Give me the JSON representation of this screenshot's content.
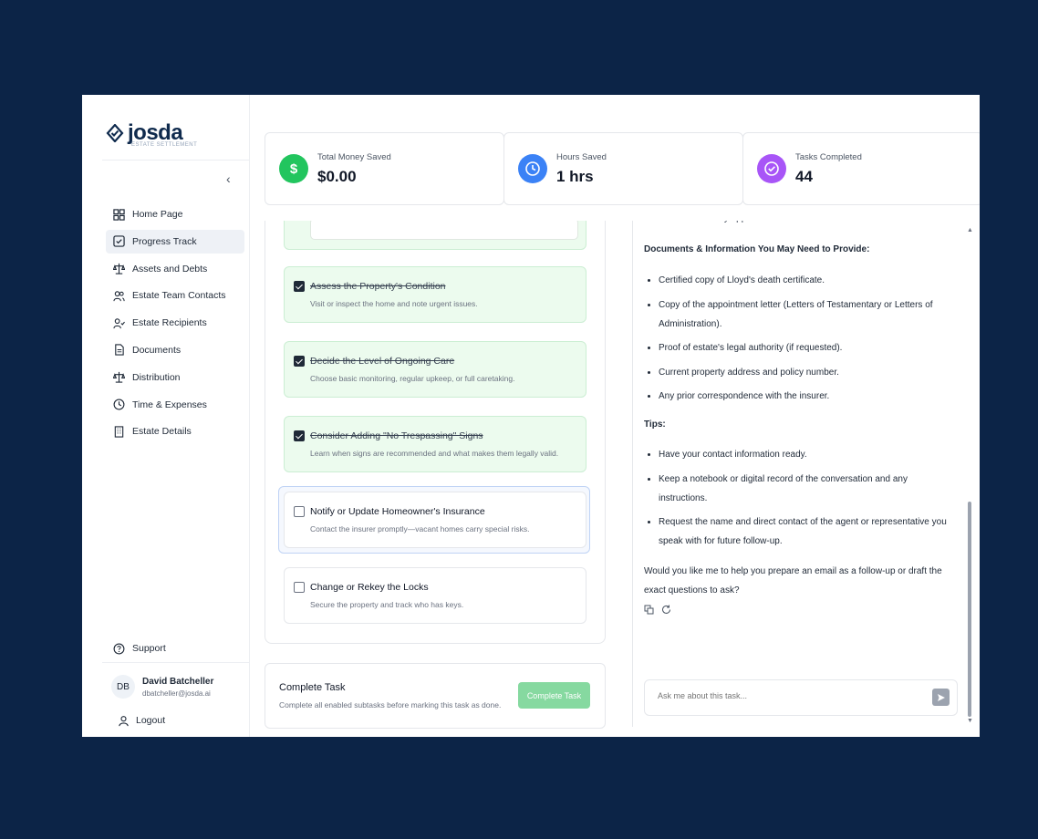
{
  "brand": {
    "name": "josda",
    "tagline": "ESTATE SETTLEMENT"
  },
  "sidebar": {
    "items": [
      {
        "label": "Home Page",
        "icon": "grid-icon"
      },
      {
        "label": "Progress Track",
        "icon": "checkbox-icon"
      },
      {
        "label": "Assets and Debts",
        "icon": "scale-icon"
      },
      {
        "label": "Estate Team Contacts",
        "icon": "users-icon"
      },
      {
        "label": "Estate Recipients",
        "icon": "user-check-icon"
      },
      {
        "label": "Documents",
        "icon": "file-icon"
      },
      {
        "label": "Distribution",
        "icon": "scale-icon"
      },
      {
        "label": "Time & Expenses",
        "icon": "clock-icon"
      },
      {
        "label": "Estate Details",
        "icon": "building-icon"
      }
    ],
    "support": "Support",
    "user": {
      "initials": "DB",
      "name": "David Batcheller",
      "email": "dbatcheller@josda.ai"
    },
    "logout": "Logout"
  },
  "stats": [
    {
      "label": "Total Money Saved",
      "value": "$0.00",
      "color": "#22c55e"
    },
    {
      "label": "Hours Saved",
      "value": "1 hrs",
      "color": "#3b82f6"
    },
    {
      "label": "Tasks Completed",
      "value": "44",
      "color": "#a855f7"
    }
  ],
  "tasks": [
    {
      "title": "Assess the Property's Condition",
      "desc": "Visit or inspect the home and note urgent issues.",
      "done": true
    },
    {
      "title": "Decide the Level of Ongoing Care",
      "desc": "Choose basic monitoring, regular upkeep, or full caretaking.",
      "done": true
    },
    {
      "title": "Consider Adding \"No Trespassing\" Signs",
      "desc": "Learn when signs are recommended and what makes them legally valid.",
      "done": true
    },
    {
      "title": "Notify or Update Homeowner's Insurance",
      "desc": "Contact the insurer promptly—vacant homes carry special risks.",
      "done": false
    },
    {
      "title": "Change or Rekey the Locks",
      "desc": "Secure the property and track who has keys.",
      "done": false
    }
  ],
  "complete": {
    "title": "Complete Task",
    "desc": "Complete all enabled subtasks before marking this task as done.",
    "button": "Complete Task"
  },
  "chat": {
    "partial_top": "documentation of my appointment as executor if needed.",
    "docs_heading": "Documents & Information You May Need to Provide:",
    "docs": [
      "Certified copy of Lloyd's death certificate.",
      "Copy of the appointment letter (Letters of Testamentary or Letters of Administration).",
      "Proof of estate's legal authority (if requested).",
      "Current property address and policy number.",
      "Any prior correspondence with the insurer."
    ],
    "tips_heading": "Tips:",
    "tips": [
      "Have your contact information ready.",
      "Keep a notebook or digital record of the conversation and any instructions.",
      "Request the name and direct contact of the agent or representative you speak with for future follow-up."
    ],
    "closing": "Would you like me to help you prepare an email as a follow-up or draft the exact questions to ask?",
    "input_placeholder": "Ask me about this task..."
  }
}
